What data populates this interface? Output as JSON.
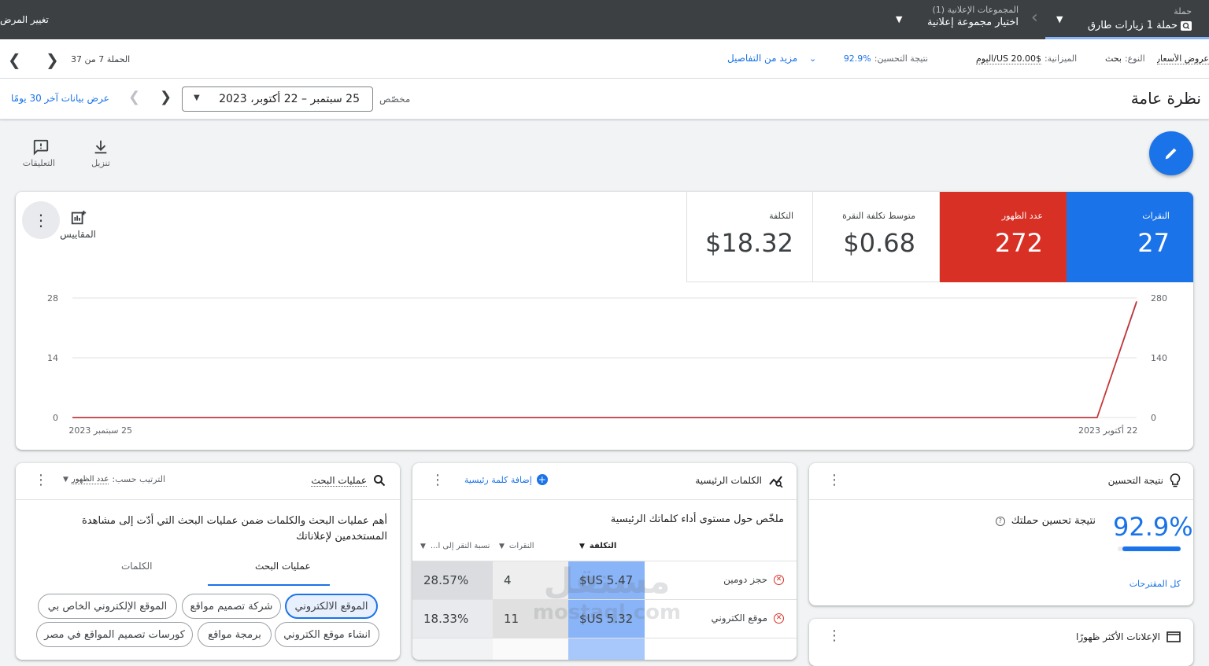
{
  "topbar": {
    "change_scope": "تغيير المرض",
    "adgroups_label": "المجموعات الإعلانية (1)",
    "adgroups_value": "اختيار مجموعة إعلانية",
    "campaign_label": "حملة",
    "campaign_value": "حملة 1 زيارات طارق"
  },
  "infobar": {
    "pager_text": "الحملة 7 من 37",
    "more_details": "مزيد من التفاصيل",
    "score_label": "نتيجة التحسين:",
    "score_value": "92.9%",
    "budget_label": "الميزانية:",
    "budget_value": "$US 20.00/اليوم",
    "type_label": "النوع:",
    "type_value": "بحث",
    "bid_strategy": "عروض الأسعار"
  },
  "overview": {
    "title": "نظرة عامة",
    "range_label": "مخصّص",
    "date_range": "25 سبتمبر – 22 أكتوبر، 2023",
    "last30": "عرض بيانات آخر 30 يومًا"
  },
  "toolbar": {
    "download_label": "تنزيل",
    "feedback_label": "التعليقات"
  },
  "metrics": [
    {
      "label": "النقرات",
      "value": "27",
      "color": "#1a73e8"
    },
    {
      "label": "عدد الظهور",
      "value": "272",
      "color": "#d93025"
    },
    {
      "label": "متوسط تكلفة النقرة",
      "value": "$0.68",
      "color": "#ffffff"
    },
    {
      "label": "التكلفة",
      "value": "$18.32",
      "color": "#ffffff"
    }
  ],
  "metrics_button_label": "المقاييس",
  "chart_data": {
    "type": "line",
    "x_start_label": "25 سبتمبر 2023",
    "x_end_label": "22 أكتوبر 2023",
    "left_axis_ticks": [
      "28",
      "14",
      "0"
    ],
    "right_axis_ticks": [
      "280",
      "140",
      "0"
    ],
    "ylim_left": [
      0,
      28
    ],
    "ylim_right": [
      0,
      280
    ],
    "series": [
      {
        "name": "النقرات",
        "color": "#1a73e8",
        "axis": "left",
        "values": [
          0,
          0,
          0,
          0,
          0,
          0,
          0,
          0,
          0,
          0,
          0,
          0,
          0,
          0,
          0,
          0,
          0,
          0,
          0,
          0,
          0,
          0,
          0,
          0,
          0,
          0,
          0,
          27
        ]
      },
      {
        "name": "عدد الظهور",
        "color": "#d93025",
        "axis": "right",
        "values": [
          0,
          0,
          0,
          0,
          0,
          0,
          0,
          0,
          0,
          0,
          0,
          0,
          0,
          0,
          0,
          0,
          0,
          0,
          0,
          0,
          0,
          0,
          0,
          0,
          0,
          0,
          0,
          272
        ]
      }
    ]
  },
  "search_card": {
    "title": "عمليات البحث",
    "sort_label": "الترتيب حسب:",
    "sort_value": "عدد الظهور",
    "description": "أهم عمليات البحث والكلمات ضمن عمليات البحث التي أدّت إلى مشاهدة المستخدمين لإعلاناتك",
    "tabs": [
      "عمليات البحث",
      "الكلمات"
    ],
    "chips": [
      "الموقع الالكتروني",
      "شركة تصميم مواقع",
      "الموقع الإلكتروني الخاص بي",
      "انشاء موقع الكتروني",
      "برمجة مواقع",
      "كورسات تصميم المواقع في مصر"
    ]
  },
  "keywords_card": {
    "title": "الكلمات الرئيسية",
    "add_keyword": "إضافة كلمة رئيسية",
    "summary": "ملخّص حول مستوى أداء كلماتك الرئيسية",
    "columns": [
      "التكلفة",
      "النقرات",
      "نسبة النقر إلى ا..."
    ],
    "rows": [
      {
        "keyword": "حجز دومين",
        "cost": "$US 5.47",
        "clicks": "4",
        "ctr": "28.57%"
      },
      {
        "keyword": "موقع الكتروني",
        "cost": "$US 5.32",
        "clicks": "11",
        "ctr": "18.33%"
      }
    ]
  },
  "optimization_card": {
    "title": "نتيجة التحسين",
    "value": "92.9%",
    "fraction": 0.929,
    "label": "نتيجة تحسين حملتك",
    "all_recs": "كل المقترحات"
  },
  "top_ads_card": {
    "title": "الإعلانات الأكثر ظهورًا"
  },
  "watermark": {
    "text": "مستقل",
    "sub": "mostaql.com"
  }
}
